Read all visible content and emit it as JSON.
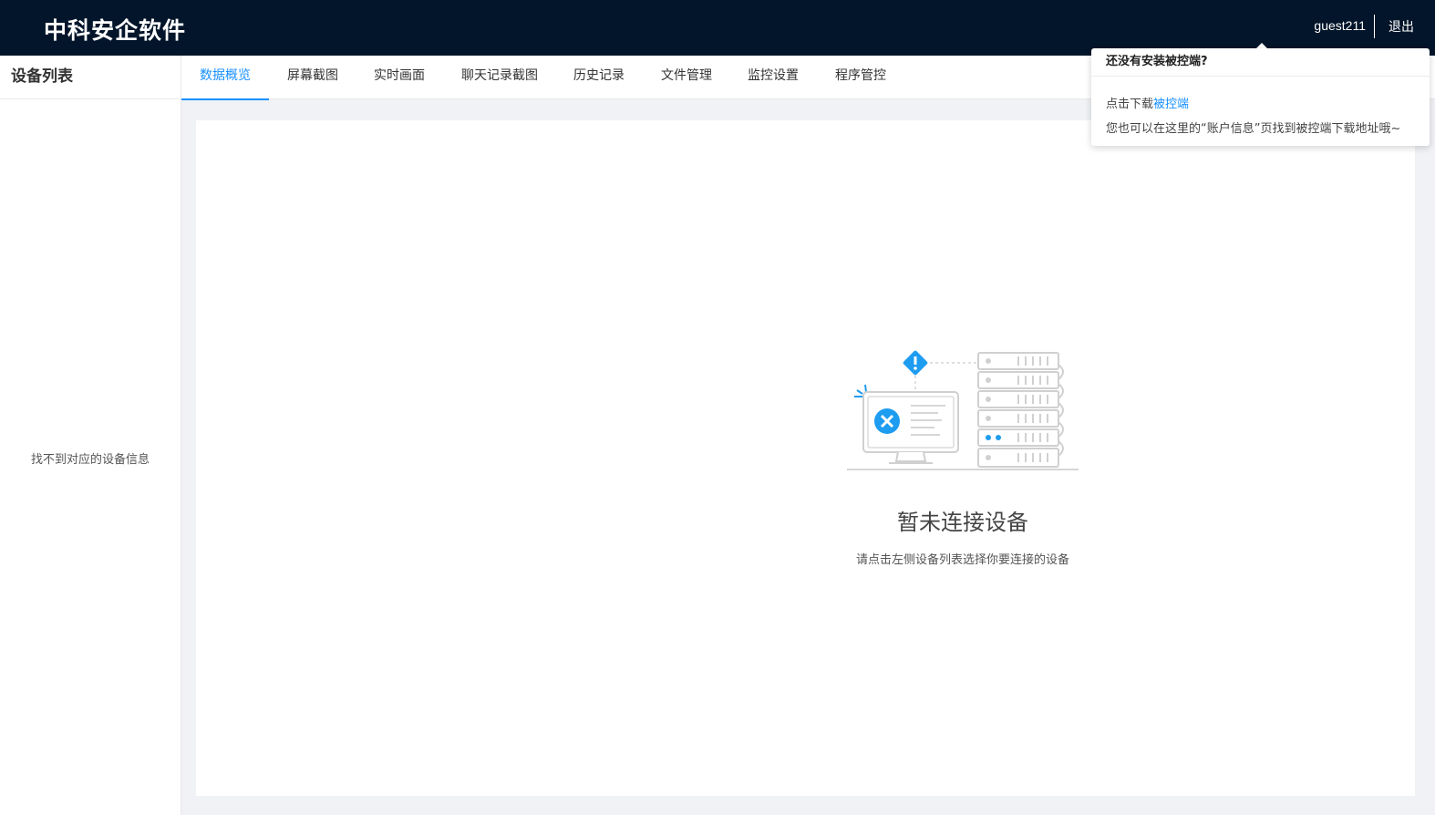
{
  "header": {
    "brand": "中科安企软件",
    "username": "guest211",
    "logout_label": "退出"
  },
  "sidebar": {
    "title": "设备列表",
    "empty_text": "找不到对应的设备信息"
  },
  "tabs": [
    {
      "label": "数据概览",
      "active": true
    },
    {
      "label": "屏幕截图"
    },
    {
      "label": "实时画面"
    },
    {
      "label": "聊天记录截图"
    },
    {
      "label": "历史记录"
    },
    {
      "label": "文件管理"
    },
    {
      "label": "监控设置"
    },
    {
      "label": "程序管控"
    }
  ],
  "main": {
    "empty_title": "暂未连接设备",
    "empty_desc": "请点击左侧设备列表选择你要连接的设备"
  },
  "popover": {
    "title": "还没有安装被控端?",
    "line1_prefix": "点击下载",
    "line1_link": "被控端",
    "line2": "您也可以在这里的“账户信息”页找到被控端下载地址哦~"
  },
  "colors": {
    "header_bg": "#02152a",
    "accent": "#1890ff",
    "page_bg": "#f0f2f5"
  }
}
